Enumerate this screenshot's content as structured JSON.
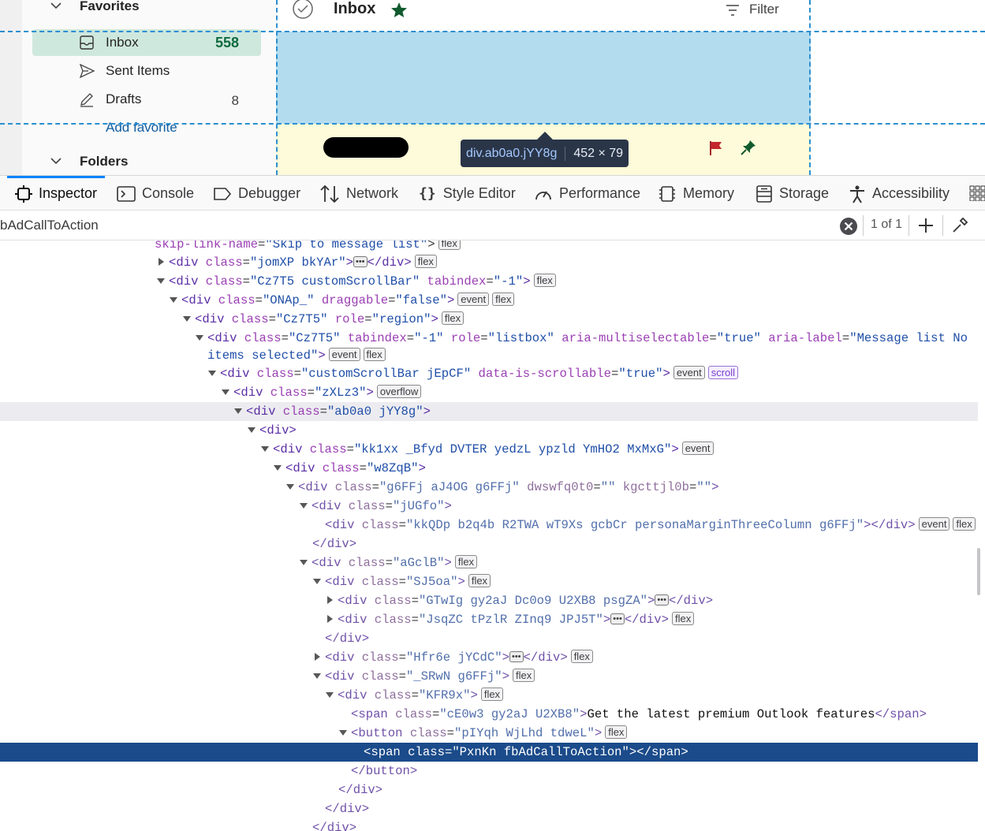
{
  "outlook": {
    "favorites_header": "Favorites",
    "folders_header": "Folders",
    "nav": [
      {
        "label": "Inbox",
        "count": "558",
        "icon": "inbox-icon"
      },
      {
        "label": "Sent Items",
        "count": "",
        "icon": "send-icon"
      },
      {
        "label": "Drafts",
        "count": "8",
        "icon": "drafts-icon"
      }
    ],
    "add_favorite": "Add favorite",
    "list_title": "Inbox",
    "filter_label": "Filter"
  },
  "highlighter": {
    "selector": "div.ab0a0.jYY8g",
    "size": "452 × 79"
  },
  "devtools": {
    "tabs": [
      "Inspector",
      "Console",
      "Debugger",
      "Network",
      "Style Editor",
      "Performance",
      "Memory",
      "Storage",
      "Accessibility"
    ],
    "search_text": "bAdCallToAction",
    "search_count": "1 of 1"
  },
  "markup": [
    {
      "text_pre": "skip-link-name=\"Skip to message list\">",
      "badge": "flex"
    },
    {
      "tag": "div",
      "attrs": "class=\"jomXP bkYAr\"",
      "collapsed": true,
      "badge": "flex"
    },
    {
      "tag": "div",
      "attrs": "class=\"Cz7T5 customScrollBar\" tabindex=\"-1\"",
      "badge": "flex"
    },
    {
      "tag": "div",
      "attrs": "class=\"ONAp_\" draggable=\"false\"",
      "badges": [
        "event",
        "flex"
      ]
    },
    {
      "tag": "div",
      "attrs": "class=\"Cz7T5\" role=\"region\"",
      "badge": "flex"
    },
    {
      "tag": "div",
      "attrs": "class=\"Cz7T5\" tabindex=\"-1\" role=\"listbox\" aria-multiselectable=\"true\" aria-label=\"Message list No items selected\"",
      "badges": [
        "event",
        "flex"
      ]
    },
    {
      "tag": "div",
      "attrs": "class=\"customScrollBar jEpCF\" data-is-scrollable=\"true\"",
      "badges": [
        "event",
        "scroll"
      ]
    },
    {
      "tag": "div",
      "attrs": "class=\"zXLz3\"",
      "badge": "overflow"
    },
    {
      "tag": "div",
      "attrs": "class=\"ab0a0 jYY8g\""
    },
    {
      "tag": "div"
    },
    {
      "tag": "div",
      "attrs": "class=\"kk1xx _Bfyd DVTER yedzL ypzld YmHO2 MxMxG\"",
      "badge": "event"
    },
    {
      "tag": "div",
      "attrs": "class=\"w8ZqB\""
    },
    {
      "tag": "div",
      "attrs": "class=\"g6FFj aJ4OG g6FFj\" dwswfq0t0=\"\" kgcttjl0b=\"\""
    },
    {
      "tag": "div",
      "attrs": "class=\"jUGfo\""
    },
    {
      "tag": "div",
      "attrs": "class=\"kkQDp b2q4b R2TWA wT9Xs gcbCr personaMarginThreeColumn g6FFj\"",
      "badges": [
        "event",
        "flex"
      ]
    },
    {
      "close": "div"
    },
    {
      "tag": "div",
      "attrs": "class=\"aGclB\"",
      "badge": "flex"
    },
    {
      "tag": "div",
      "attrs": "class=\"SJ5oa\"",
      "badge": "flex"
    },
    {
      "tag": "div",
      "attrs": "class=\"GTwIg gy2aJ Dc0o9 U2XB8 psgZA\""
    },
    {
      "tag": "div",
      "attrs": "class=\"JsqZC tPzlR ZInq9 JPJ5T\"",
      "badge": "flex"
    },
    {
      "close": "div"
    },
    {
      "tag": "div",
      "attrs": "class=\"Hfr6e jYCdC\"",
      "badge": "flex"
    },
    {
      "tag": "div",
      "attrs": "class=\"_SRwN g6FFj\"",
      "badge": "flex"
    },
    {
      "tag": "div",
      "attrs": "class=\"KFR9x\"",
      "badge": "flex"
    },
    {
      "tag": "span",
      "attrs": "class=\"cE0w3 gy2aJ U2XB8\"",
      "text": "Get the latest premium Outlook features"
    },
    {
      "tag": "button",
      "attrs": "class=\"pIYqh WjLhd tdweL\"",
      "badge": "flex"
    },
    {
      "tag": "span",
      "attrs": "class=\"PxnKn fbAdCallToAction\""
    },
    {
      "close": "button"
    },
    {
      "close": "div"
    },
    {
      "close": "div"
    },
    {
      "close": "div"
    }
  ]
}
